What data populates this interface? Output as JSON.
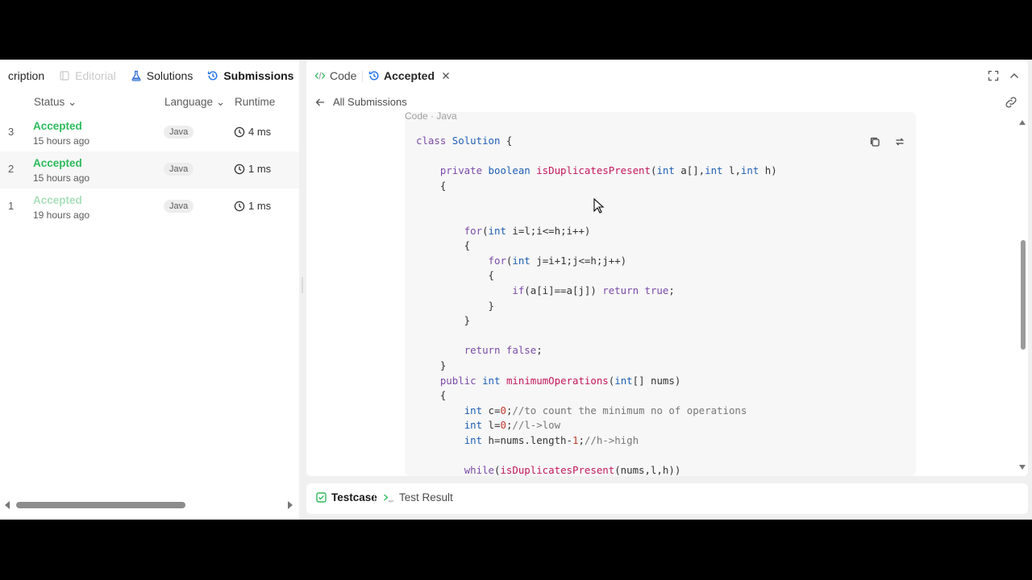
{
  "left_panel": {
    "tabs": [
      {
        "label": "cription",
        "icon": "description-icon",
        "state": "normal"
      },
      {
        "label": "Editorial",
        "icon": "book-icon",
        "state": "disabled"
      },
      {
        "label": "Solutions",
        "icon": "flask-icon",
        "state": "normal"
      },
      {
        "label": "Submissions",
        "icon": "history-icon",
        "state": "active"
      }
    ],
    "columns": {
      "status": "Status",
      "language": "Language",
      "runtime": "Runtime"
    },
    "rows": [
      {
        "num": "3",
        "status": "Accepted",
        "time": "15 hours ago",
        "lang": "Java",
        "runtime": "4 ms"
      },
      {
        "num": "2",
        "status": "Accepted",
        "time": "15 hours ago",
        "lang": "Java",
        "runtime": "1 ms"
      },
      {
        "num": "1",
        "status": "Accepted",
        "time": "19 hours ago",
        "lang": "Java",
        "runtime": "1 ms"
      }
    ]
  },
  "right_panel": {
    "tabs": {
      "code": "Code",
      "accepted": "Accepted"
    },
    "back_label": "All Submissions",
    "code_header": "Code · Java"
  },
  "bottom_panel": {
    "testcase": "Testcase",
    "test_result": "Test Result"
  },
  "colors": {
    "accepted": "#2cbb5d",
    "active_tab_icon": "#1f6feb",
    "testcase_icon": "#2cbb5d"
  }
}
